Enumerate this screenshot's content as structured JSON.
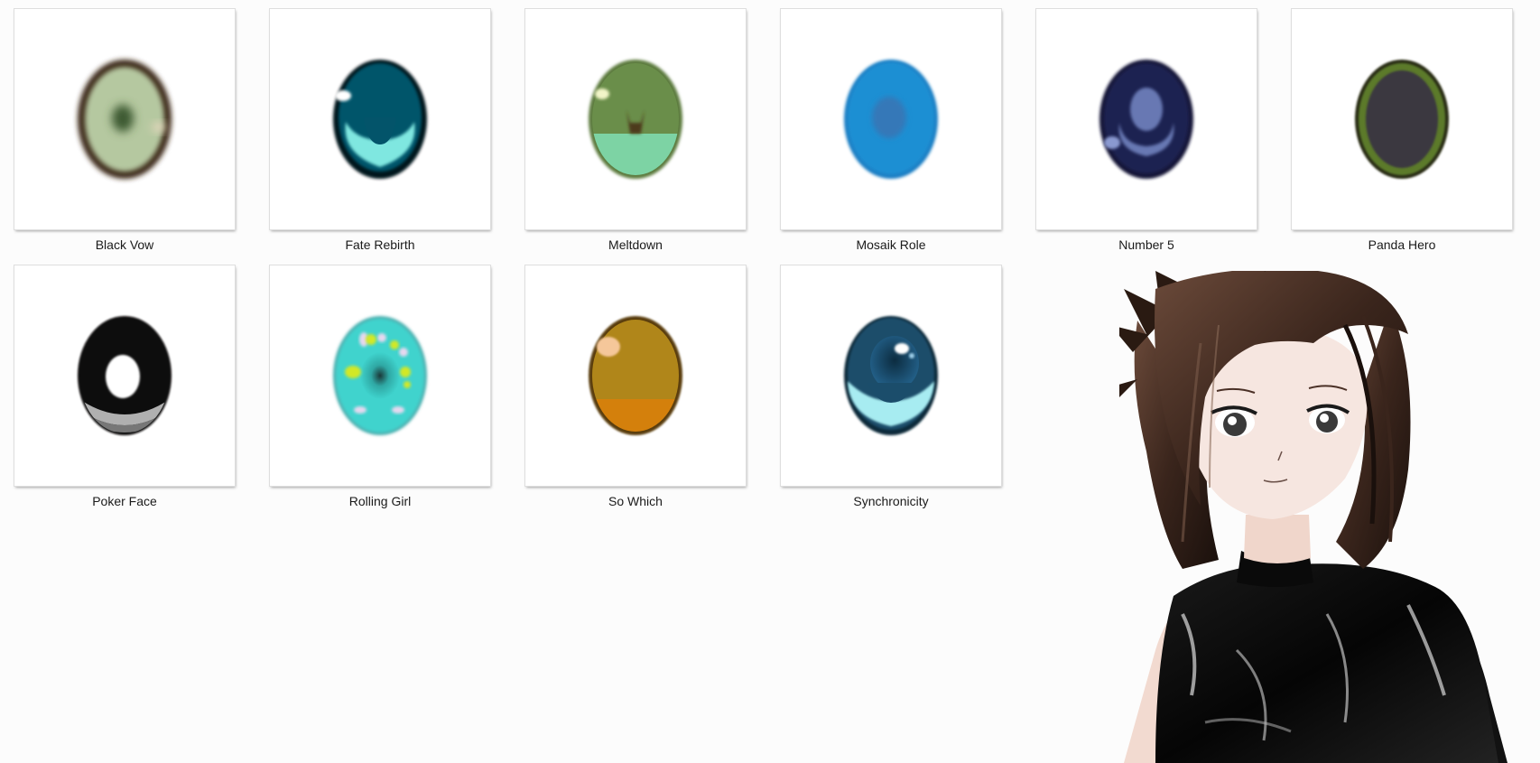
{
  "items": [
    {
      "name": "Black Vow",
      "icon": "eye-texture-black-vow-icon",
      "colors": {
        "rim": "#3b2613",
        "iris": "#b5c8a0",
        "pupil": "#3e5a32"
      }
    },
    {
      "name": "Fate Rebirth",
      "icon": "eye-texture-fate-rebirth-icon",
      "colors": {
        "rim": "#04161c",
        "iris": "#03546a",
        "highlight": "#7fe7e0"
      }
    },
    {
      "name": "Meltdown",
      "icon": "eye-texture-meltdown-icon",
      "colors": {
        "rim": "#5c7a3e",
        "iris": "#6a8e4a",
        "lower": "#7dd3a4"
      }
    },
    {
      "name": "Mosaik Role",
      "icon": "eye-texture-mosaik-role-icon",
      "colors": {
        "rim": "#1c7fc4",
        "iris": "#1f8fd3",
        "pupil": "#3678b8"
      }
    },
    {
      "name": "Number 5",
      "icon": "eye-texture-number-5-icon",
      "colors": {
        "rim": "#141838",
        "iris": "#1f2451",
        "pupil": "#6878b3"
      }
    },
    {
      "name": "Panda Hero",
      "icon": "eye-texture-panda-hero-icon",
      "colors": {
        "rim": "#2a2d18",
        "ring": "#5c7a2c",
        "iris": "#3a3940"
      }
    },
    {
      "name": "Poker Face",
      "icon": "eye-texture-poker-face-icon",
      "colors": {
        "rim": "#100808",
        "iris": "#1b1010",
        "pupil": "#ffffff",
        "lower": "#b0b0b0"
      }
    },
    {
      "name": "Rolling Girl",
      "icon": "eye-texture-rolling-girl-icon",
      "colors": {
        "rim": "#4fb0b0",
        "iris": "#3fd3cd",
        "pupil": "#1a3838",
        "spot": "#d2e826"
      }
    },
    {
      "name": "So Which",
      "icon": "eye-texture-so-which-icon",
      "colors": {
        "rim": "#5a3d0c",
        "iris": "#b0861a",
        "lower": "#d4800c"
      }
    },
    {
      "name": "Synchronicity",
      "icon": "eye-texture-synchronicity-icon",
      "colors": {
        "rim": "#0d2a3a",
        "iris": "#1b4d6b",
        "highlight": "#a7ecf1"
      }
    }
  ]
}
